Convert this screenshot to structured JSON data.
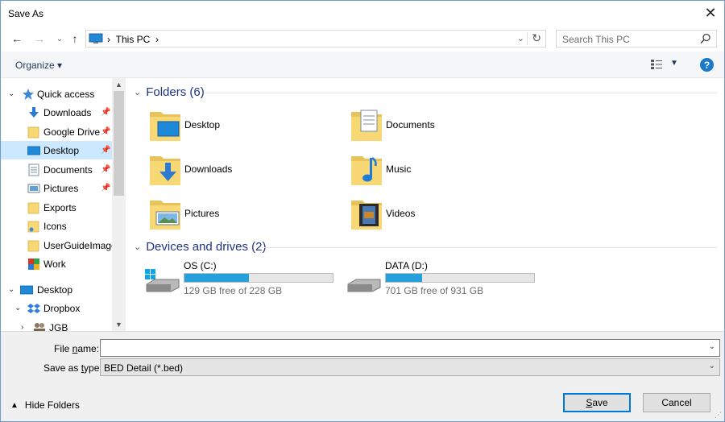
{
  "window": {
    "title": "Save As",
    "close_glyph": "✕"
  },
  "nav": {
    "back_glyph": "←",
    "forward_glyph": "→",
    "recent_glyph": "⌄",
    "up_glyph": "↑",
    "breadcrumb": "This PC",
    "breadcrumb_sep": "›",
    "search_placeholder": "Search This PC"
  },
  "toolbar": {
    "organize_label": "Organize ▾",
    "help_label": "?"
  },
  "sidebar": {
    "items": [
      {
        "label": "Quick access",
        "icon": "star-icon",
        "pinned": false
      },
      {
        "label": "Downloads",
        "icon": "download-arrow-icon",
        "pinned": true
      },
      {
        "label": "Google Drive",
        "icon": "folder-icon",
        "pinned": true
      },
      {
        "label": "Desktop",
        "icon": "desktop-icon",
        "pinned": true,
        "selected": true
      },
      {
        "label": "Documents",
        "icon": "documents-icon",
        "pinned": true
      },
      {
        "label": "Pictures",
        "icon": "pictures-icon",
        "pinned": true
      },
      {
        "label": "Exports",
        "icon": "folder-icon",
        "pinned": false
      },
      {
        "label": "Icons",
        "icon": "folder-icon",
        "pinned": false
      },
      {
        "label": "UserGuideImages",
        "icon": "folder-icon",
        "pinned": false
      },
      {
        "label": "Work",
        "icon": "work-icon",
        "pinned": false
      },
      {
        "label": "Desktop",
        "icon": "desktop-icon",
        "pinned": false
      },
      {
        "label": "Dropbox",
        "icon": "dropbox-icon",
        "pinned": false
      },
      {
        "label": "JGB",
        "icon": "users-icon",
        "pinned": false
      }
    ]
  },
  "content": {
    "folders_header": "Folders (6)",
    "folders": [
      {
        "label": "Desktop",
        "icon": "desktop-folder-icon"
      },
      {
        "label": "Documents",
        "icon": "documents-folder-icon"
      },
      {
        "label": "Downloads",
        "icon": "downloads-folder-icon"
      },
      {
        "label": "Music",
        "icon": "music-folder-icon"
      },
      {
        "label": "Pictures",
        "icon": "pictures-folder-icon"
      },
      {
        "label": "Videos",
        "icon": "videos-folder-icon"
      }
    ],
    "drives_header": "Devices and drives (2)",
    "drives": [
      {
        "label": "OS (C:)",
        "free_text": "129 GB free of 228 GB",
        "used_fraction": 0.434,
        "icon": "windows-drive-icon"
      },
      {
        "label": "DATA (D:)",
        "free_text": "701 GB free of 931 GB",
        "used_fraction": 0.247,
        "icon": "drive-icon"
      }
    ]
  },
  "form": {
    "filename_label_pre": "File ",
    "filename_label_u": "n",
    "filename_label_post": "ame:",
    "filename_value": "",
    "savetype_label_pre": "Save as ",
    "savetype_label_u": "t",
    "savetype_label_post": "ype:",
    "savetype_value": "BED Detail (*.bed)",
    "hide_folders_label": "Hide Folders",
    "save_label_u": "S",
    "save_label_post": "ave",
    "cancel_label": "Cancel"
  },
  "colors": {
    "accent": "#0078d7",
    "selection": "#cce8ff",
    "drive_fill": "#26a0da",
    "header_text": "#1e3287"
  }
}
